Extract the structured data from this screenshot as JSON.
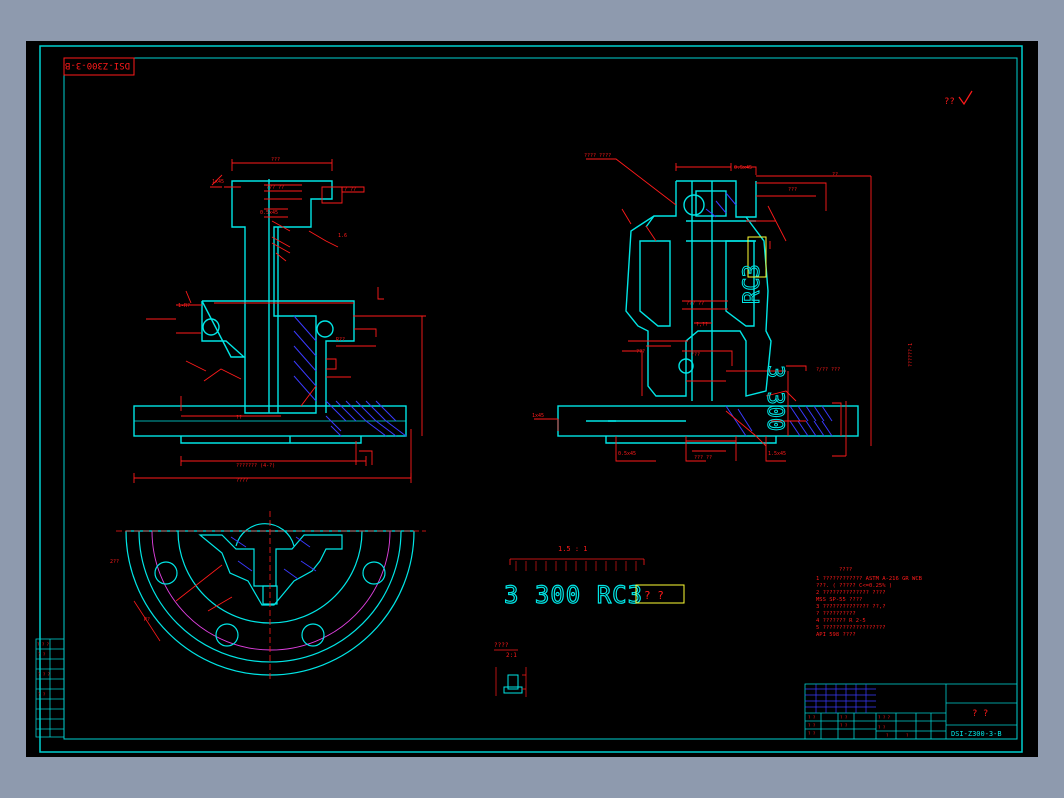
{
  "drawing": {
    "code_rotated": "DSI-Z300-3-B",
    "code_titleblock": "DSI-Z300-3-B",
    "title_mark": "? ?",
    "surface_mark": "??",
    "scale_label": "1.5 : 1",
    "detail_scale": "2:1",
    "detail_label": "????",
    "big_label_main": "3 300 RC3",
    "big_label_suffix": "? ?",
    "side_stamp": "RC3",
    "side_stamp2": "3 300",
    "notes_title": "????",
    "notes": [
      "1  ???????????? ASTM A-216 GR WCB",
      "   ???. ( ????? C<=0.25% )",
      "2  ?????????????? ????",
      "   MSS SP-55 ????",
      "3  ?????????????? ??,?",
      "   ? ??????????",
      "4  ??????? R 2-5",
      "5  ???????????????????",
      "   API 598 ????"
    ]
  },
  "colors": {
    "background": "#000000",
    "frame": "#00cfcf",
    "body": "#00e5e5",
    "dimension": "#ff1a1a",
    "label": "#ffff33",
    "hatch": "#3a3aff",
    "white": "#ffffff",
    "magenta": "#e040e0"
  },
  "icons": {
    "surface_mark": "surface-finish-check-icon"
  }
}
